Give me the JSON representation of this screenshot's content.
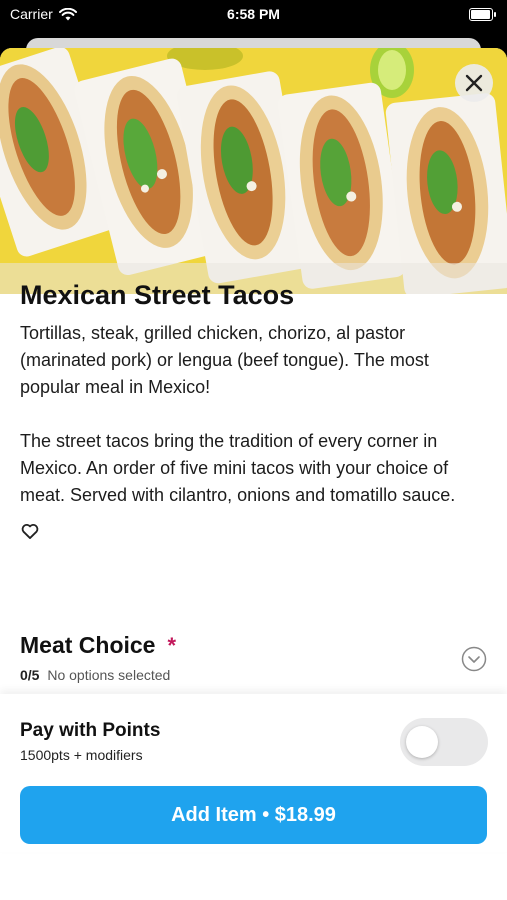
{
  "status_bar": {
    "carrier": "Carrier",
    "time": "6:58 PM",
    "battery_level": 1.0
  },
  "item": {
    "title": "Mexican Street Tacos",
    "description_1": "Tortillas, steak, grilled chicken, chorizo, al pastor (marinated pork) or lengua (beef tongue). The most popular meal in Mexico!",
    "description_2": "The street tacos bring the tradition of every corner in Mexico. An order of five mini tacos with your choice of meat. Served with cilantro, onions and tomatillo sauce.",
    "hero_image": "mexican-street-tacos-photo"
  },
  "meat_choice": {
    "title": "Meat Choice",
    "required_mark": "*",
    "count": "0/5",
    "status": "No options selected"
  },
  "points": {
    "title": "Pay with Points",
    "subtitle": "1500pts + modifiers",
    "toggle_on": false
  },
  "add_button": {
    "label": "Add Item • $18.99"
  },
  "icons": {
    "close": "close-icon",
    "favorite": "heart-icon",
    "expand": "chevron-down-circle-icon",
    "wifi": "wifi-icon",
    "battery": "battery-icon"
  },
  "colors": {
    "accent": "#1fa3ee",
    "required": "#c2185b",
    "toggle_off": "#e9e9ea"
  }
}
